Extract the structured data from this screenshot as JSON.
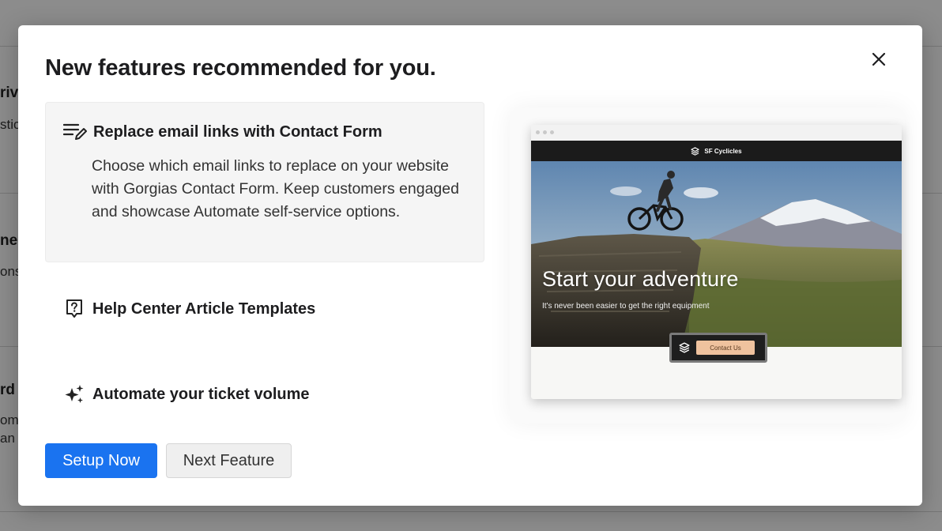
{
  "background": {
    "fragments": [
      "rive",
      "stic",
      "ne",
      "ons,",
      "rd",
      "om",
      "an"
    ]
  },
  "modal": {
    "title": "New features recommended for you.",
    "close_icon": "close-icon"
  },
  "features": [
    {
      "title": "Replace email links with Contact Form",
      "icon": "edit-list-icon",
      "description": "Choose which email links to replace on your website with Gorgias Contact Form. Keep customers engaged and showcase Automate self-service options.",
      "active": true
    },
    {
      "title": "Help Center Article Templates",
      "icon": "help-article-icon",
      "active": false
    },
    {
      "title": "Automate your ticket volume",
      "icon": "sparkles-icon",
      "active": false
    }
  ],
  "actions": {
    "primary_label": "Setup Now",
    "secondary_label": "Next Feature"
  },
  "preview": {
    "brand": "SF Cyclicles",
    "headline": "Start your adventure",
    "subheadline": "It's never been easier to get the right equipment",
    "contact_button": "Contact Us"
  },
  "colors": {
    "primary": "#1a73f0",
    "overlay": "rgba(0,0,0,0.45)",
    "active_card": "#f5f5f5",
    "contact_button": "#efc29e"
  }
}
